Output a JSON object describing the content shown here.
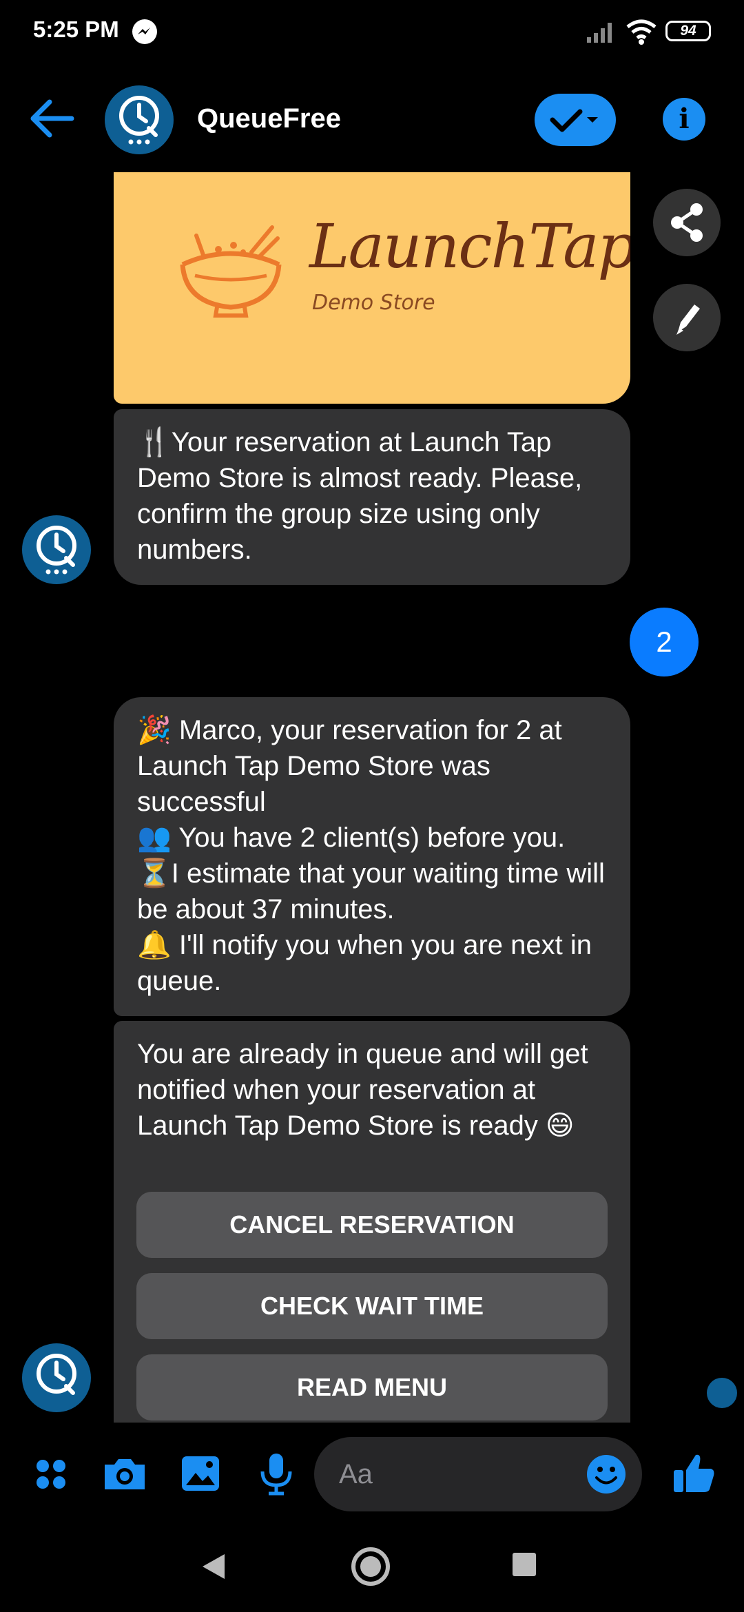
{
  "status_bar": {
    "time": "5:25 PM",
    "battery": "94"
  },
  "header": {
    "title": "QueueFree"
  },
  "banner": {
    "title": "LaunchTap",
    "subtitle": "Demo Store"
  },
  "messages": {
    "bot_1": "🍴Your reservation at Launch Tap Demo Store is almost ready. Please, confirm the group size using only numbers.",
    "user_1": "2",
    "bot_2": "🎉 Marco, your reservation for 2 at Launch Tap Demo Store was successful\n👥 You have 2 client(s) before you.\n⏳I estimate that your waiting time will be about 37 minutes.\n🔔 I'll notify you when you are next in queue.",
    "bot_3": "You are already in queue and will get notified when your reservation at Launch Tap Demo Store is ready 😄"
  },
  "quick_replies": [
    "CANCEL RESERVATION",
    "CHECK WAIT TIME",
    "READ MENU"
  ],
  "composer": {
    "placeholder": "Aa"
  },
  "icons": {
    "back": "arrow-left-icon",
    "check": "check-dropdown-icon",
    "info": "info-icon",
    "share": "share-icon",
    "edit": "pencil-icon",
    "apps": "apps-grid-icon",
    "camera": "camera-icon",
    "gallery": "image-icon",
    "mic": "microphone-icon",
    "emoji": "emoji-icon",
    "like": "thumbs-up-icon"
  },
  "colors": {
    "accent": "#1b8ef2",
    "user_bubble": "#0a7cff",
    "bot_bubble": "#333334",
    "banner_bg": "#fdc96b",
    "avatar": "#0e5f94"
  }
}
